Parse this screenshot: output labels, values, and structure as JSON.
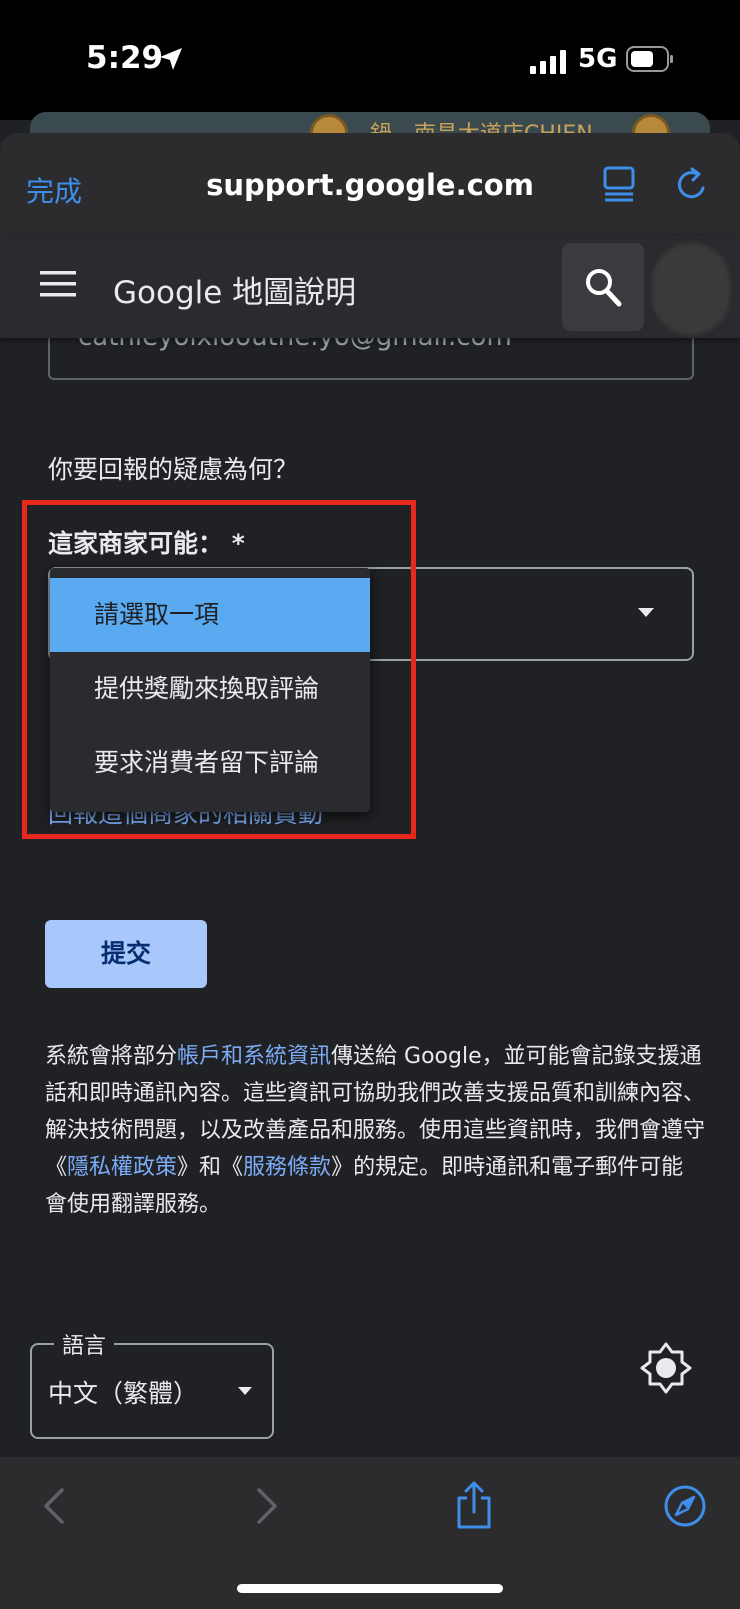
{
  "status_bar": {
    "time": "5:29",
    "network": "5G"
  },
  "map_peek": {
    "text": "鍋 - 南昌大道店CHIEN"
  },
  "browser": {
    "done_label": "完成",
    "url": "support.google.com"
  },
  "header": {
    "title": "Google 地圖說明"
  },
  "form": {
    "email_value": "cathleyolxloouthe.yo@gmail.com",
    "question": "你要回報的疑慮為何？",
    "field_label": "這家商家可能： *",
    "hidden_link": "回報這個商家的相關貧動",
    "dropdown_options": [
      "請選取一項",
      "提供獎勵來換取評論",
      "要求消費者留下評論"
    ],
    "submit_label": "提交"
  },
  "disclaimer": {
    "p1": "系統會將部分",
    "link1": "帳戶和系統資訊",
    "p2": "傳送給 Google，並可能會記錄支援通話和即時通訊內容。這些資訊可協助我們改善支援品質和訓練內容、解決技術問題，以及改善產品和服務。使用這些資訊時，我們會遵守《",
    "link2": "隱私權政策",
    "p3": "》和《",
    "link3": "服務條款",
    "p4": "》的規定。即時通訊和電子郵件可能會使用翻譯服務。"
  },
  "language": {
    "legend": "語言",
    "value": "中文（繁體）"
  },
  "colors": {
    "accent": "#3e8eea",
    "highlight_box": "#e8281c",
    "selected_option": "#5aaaf2"
  }
}
